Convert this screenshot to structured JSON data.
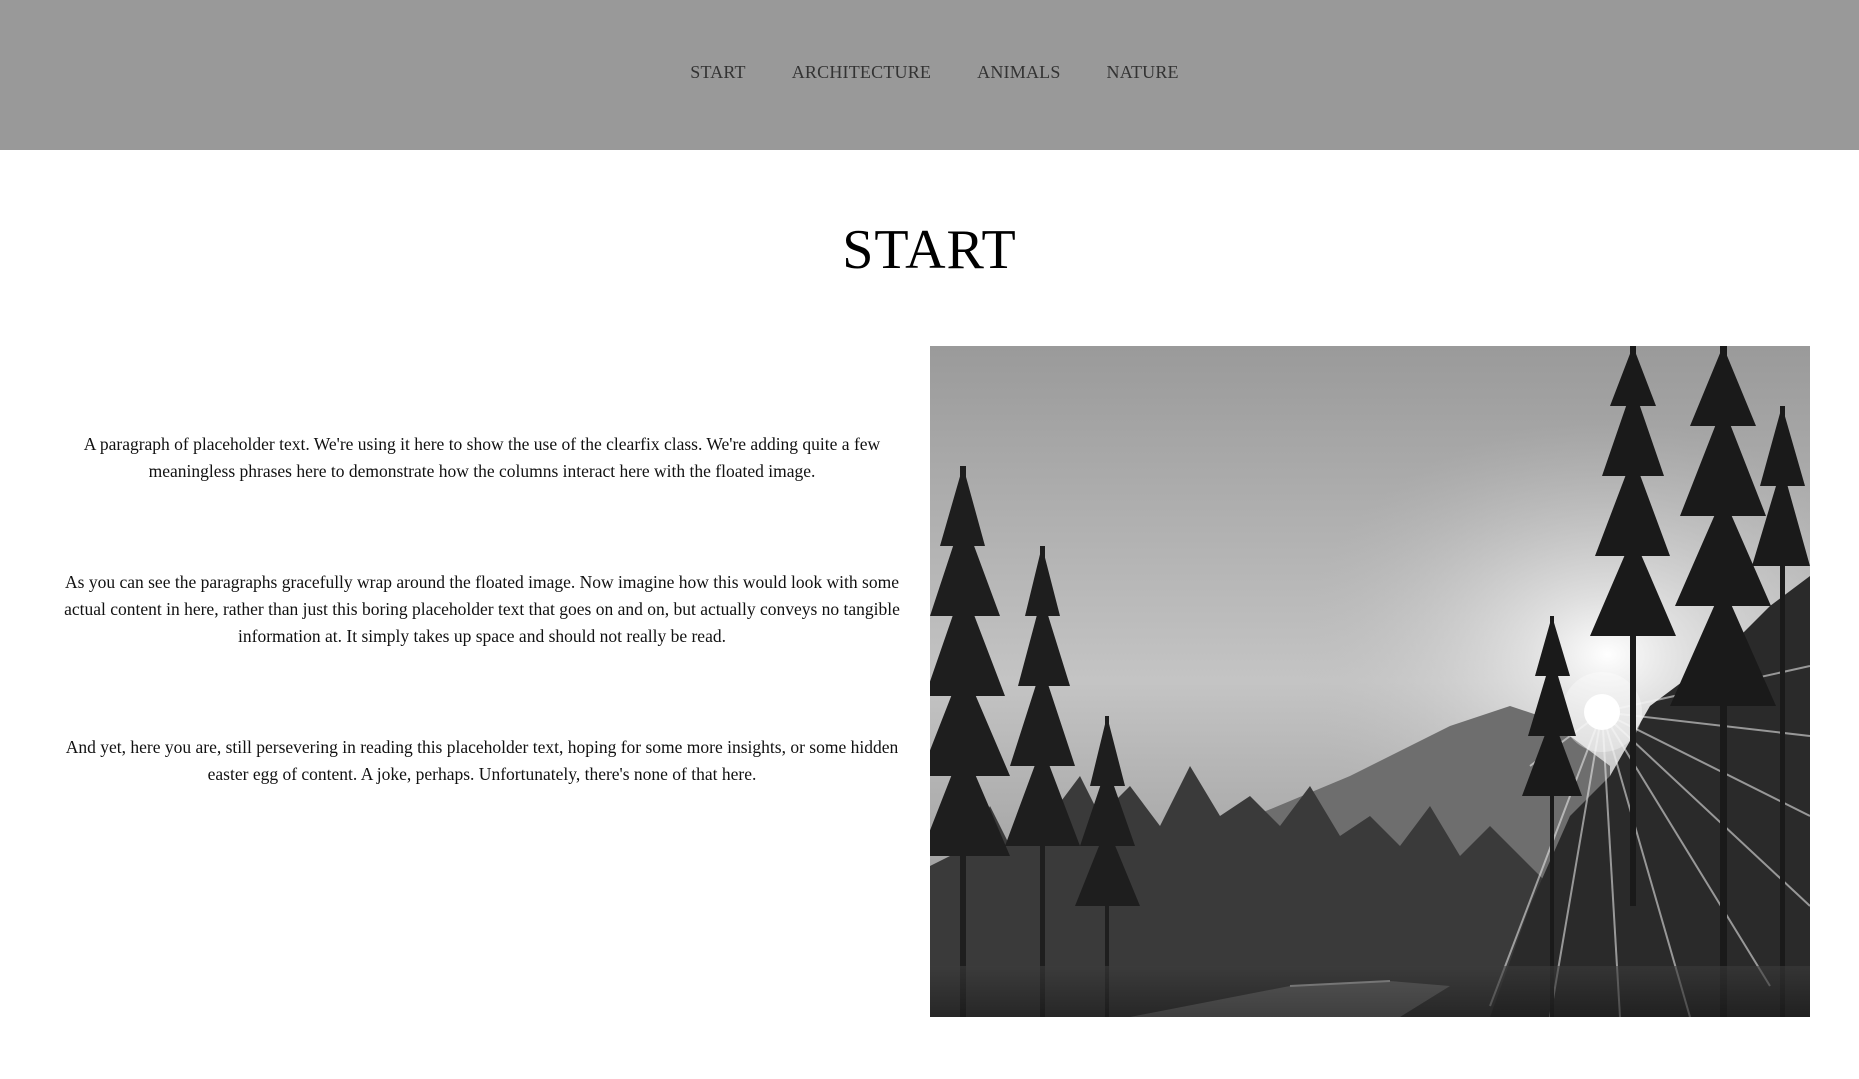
{
  "nav": {
    "items": [
      {
        "label": "START"
      },
      {
        "label": "ARCHITECTURE"
      },
      {
        "label": "ANIMALS"
      },
      {
        "label": "NATURE"
      }
    ]
  },
  "main": {
    "title": "START",
    "paragraphs": [
      "A paragraph of placeholder text. We're using it here to show the use of the clearfix class. We're adding quite a few meaningless phrases here to demonstrate how the columns interact here with the floated image.",
      "As you can see the paragraphs gracefully wrap around the floated image. Now imagine how this would look with some actual content in here, rather than just this boring placeholder text that goes on and on, but actually conveys no tangible information at. It simply takes up space and should not really be read.",
      "And yet, here you are, still persevering in reading this placeholder text, hoping for some more insights, or some hidden easter egg of content. A joke, perhaps. Unfortunately, there's none of that here."
    ],
    "image": {
      "subject": "forest-road-sunburst-photo"
    }
  },
  "colors": {
    "nav_background": "#999999",
    "nav_text": "#333333",
    "page_background": "#ffffff"
  }
}
